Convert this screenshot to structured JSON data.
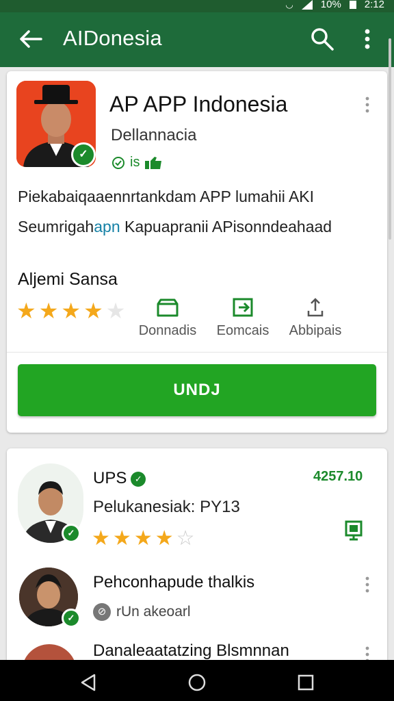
{
  "status_bar": {
    "battery": "10%",
    "time": "2:12"
  },
  "app_bar": {
    "title": "AIDonesia",
    "back_icon": "arrow-left-icon",
    "search_icon": "search-icon",
    "more_icon": "more-vert-icon"
  },
  "featured": {
    "app_name": "AP APP Indonesia",
    "developer": "Dellannacia",
    "meta": "is",
    "description_line1": "Piekabaiqaaennrtankdam APP lumahii AKI",
    "description_line2_pre": "Seumrigah",
    "description_line2_hl": "apn",
    "description_line2_post": " Kapuapranii APisonndeahaad",
    "rating_label": "Aljemi Sansa",
    "rating": 4,
    "rating_max": 5,
    "actions": [
      {
        "label": "Donnadis",
        "icon": "folder-icon"
      },
      {
        "label": "Eomcais",
        "icon": "import-icon"
      },
      {
        "label": "Abbipais",
        "icon": "share-icon"
      }
    ],
    "install_label": "UNDJ",
    "colors": {
      "primary": "#1e6b3a",
      "install": "#22a523",
      "star": "#f4a81b"
    }
  },
  "list": [
    {
      "title": "UPS",
      "subtitle": "Pelukanesiak: PY13",
      "price": "4257.10",
      "rating": 4,
      "rating_max": 5,
      "trailing_icon": "device-icon"
    },
    {
      "title": "Pehconhapude thalkis",
      "meta": "rUn akeoarl",
      "trailing_icon": "more-vert-icon"
    },
    {
      "title": "Danaleaatatzing Blsmnnan",
      "trailing_icon": "more-vert-icon"
    }
  ],
  "nav_bar": {
    "back": "nav-back-icon",
    "home": "nav-home-icon",
    "recents": "nav-recents-icon"
  }
}
